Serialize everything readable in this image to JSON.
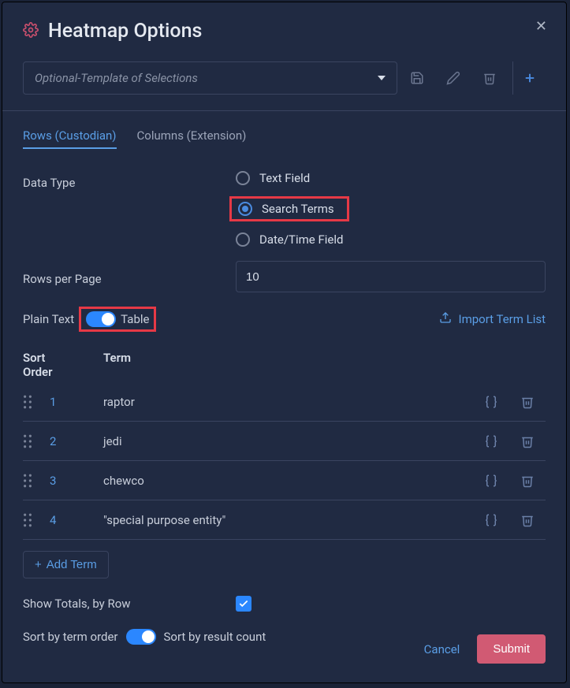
{
  "title": "Heatmap Options",
  "template": {
    "placeholder": "Optional-Template of Selections"
  },
  "tabs": {
    "rows": "Rows (Custodian)",
    "columns": "Columns (Extension)"
  },
  "dataType": {
    "label": "Data Type",
    "options": {
      "text": "Text Field",
      "search": "Search Terms",
      "datetime": "Date/Time Field"
    },
    "selected": "search"
  },
  "rowsPerPage": {
    "label": "Rows per Page",
    "value": "10"
  },
  "modeToggle": {
    "left": "Plain Text",
    "right": "Table"
  },
  "importLink": "Import Term List",
  "termTable": {
    "headers": {
      "order": "Sort Order",
      "term": "Term"
    },
    "rows": [
      {
        "order": "1",
        "term": "raptor"
      },
      {
        "order": "2",
        "term": "jedi"
      },
      {
        "order": "3",
        "term": "chewco"
      },
      {
        "order": "4",
        "term": "\"special purpose entity\""
      }
    ]
  },
  "addTerm": "Add Term",
  "showTotals": {
    "label": "Show Totals, by Row",
    "checked": true
  },
  "sortToggle": {
    "left": "Sort by term order",
    "right": "Sort by result count"
  },
  "footer": {
    "cancel": "Cancel",
    "submit": "Submit"
  }
}
